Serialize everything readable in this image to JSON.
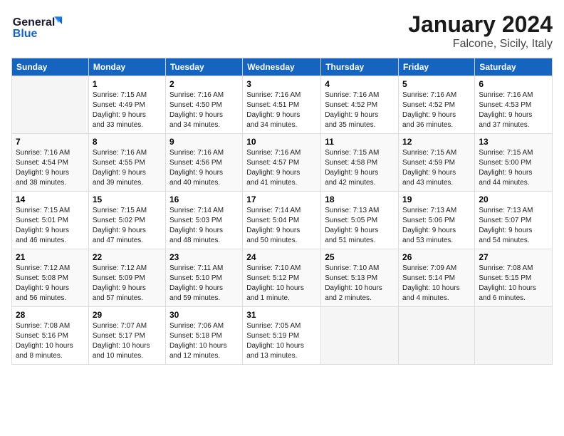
{
  "logo": {
    "line1": "General",
    "line2": "Blue"
  },
  "title": "January 2024",
  "subtitle": "Falcone, Sicily, Italy",
  "headers": [
    "Sunday",
    "Monday",
    "Tuesday",
    "Wednesday",
    "Thursday",
    "Friday",
    "Saturday"
  ],
  "weeks": [
    [
      {
        "day": "",
        "info": ""
      },
      {
        "day": "1",
        "info": "Sunrise: 7:15 AM\nSunset: 4:49 PM\nDaylight: 9 hours\nand 33 minutes."
      },
      {
        "day": "2",
        "info": "Sunrise: 7:16 AM\nSunset: 4:50 PM\nDaylight: 9 hours\nand 34 minutes."
      },
      {
        "day": "3",
        "info": "Sunrise: 7:16 AM\nSunset: 4:51 PM\nDaylight: 9 hours\nand 34 minutes."
      },
      {
        "day": "4",
        "info": "Sunrise: 7:16 AM\nSunset: 4:52 PM\nDaylight: 9 hours\nand 35 minutes."
      },
      {
        "day": "5",
        "info": "Sunrise: 7:16 AM\nSunset: 4:52 PM\nDaylight: 9 hours\nand 36 minutes."
      },
      {
        "day": "6",
        "info": "Sunrise: 7:16 AM\nSunset: 4:53 PM\nDaylight: 9 hours\nand 37 minutes."
      }
    ],
    [
      {
        "day": "7",
        "info": "Sunrise: 7:16 AM\nSunset: 4:54 PM\nDaylight: 9 hours\nand 38 minutes."
      },
      {
        "day": "8",
        "info": "Sunrise: 7:16 AM\nSunset: 4:55 PM\nDaylight: 9 hours\nand 39 minutes."
      },
      {
        "day": "9",
        "info": "Sunrise: 7:16 AM\nSunset: 4:56 PM\nDaylight: 9 hours\nand 40 minutes."
      },
      {
        "day": "10",
        "info": "Sunrise: 7:16 AM\nSunset: 4:57 PM\nDaylight: 9 hours\nand 41 minutes."
      },
      {
        "day": "11",
        "info": "Sunrise: 7:15 AM\nSunset: 4:58 PM\nDaylight: 9 hours\nand 42 minutes."
      },
      {
        "day": "12",
        "info": "Sunrise: 7:15 AM\nSunset: 4:59 PM\nDaylight: 9 hours\nand 43 minutes."
      },
      {
        "day": "13",
        "info": "Sunrise: 7:15 AM\nSunset: 5:00 PM\nDaylight: 9 hours\nand 44 minutes."
      }
    ],
    [
      {
        "day": "14",
        "info": "Sunrise: 7:15 AM\nSunset: 5:01 PM\nDaylight: 9 hours\nand 46 minutes."
      },
      {
        "day": "15",
        "info": "Sunrise: 7:15 AM\nSunset: 5:02 PM\nDaylight: 9 hours\nand 47 minutes."
      },
      {
        "day": "16",
        "info": "Sunrise: 7:14 AM\nSunset: 5:03 PM\nDaylight: 9 hours\nand 48 minutes."
      },
      {
        "day": "17",
        "info": "Sunrise: 7:14 AM\nSunset: 5:04 PM\nDaylight: 9 hours\nand 50 minutes."
      },
      {
        "day": "18",
        "info": "Sunrise: 7:13 AM\nSunset: 5:05 PM\nDaylight: 9 hours\nand 51 minutes."
      },
      {
        "day": "19",
        "info": "Sunrise: 7:13 AM\nSunset: 5:06 PM\nDaylight: 9 hours\nand 53 minutes."
      },
      {
        "day": "20",
        "info": "Sunrise: 7:13 AM\nSunset: 5:07 PM\nDaylight: 9 hours\nand 54 minutes."
      }
    ],
    [
      {
        "day": "21",
        "info": "Sunrise: 7:12 AM\nSunset: 5:08 PM\nDaylight: 9 hours\nand 56 minutes."
      },
      {
        "day": "22",
        "info": "Sunrise: 7:12 AM\nSunset: 5:09 PM\nDaylight: 9 hours\nand 57 minutes."
      },
      {
        "day": "23",
        "info": "Sunrise: 7:11 AM\nSunset: 5:10 PM\nDaylight: 9 hours\nand 59 minutes."
      },
      {
        "day": "24",
        "info": "Sunrise: 7:10 AM\nSunset: 5:12 PM\nDaylight: 10 hours\nand 1 minute."
      },
      {
        "day": "25",
        "info": "Sunrise: 7:10 AM\nSunset: 5:13 PM\nDaylight: 10 hours\nand 2 minutes."
      },
      {
        "day": "26",
        "info": "Sunrise: 7:09 AM\nSunset: 5:14 PM\nDaylight: 10 hours\nand 4 minutes."
      },
      {
        "day": "27",
        "info": "Sunrise: 7:08 AM\nSunset: 5:15 PM\nDaylight: 10 hours\nand 6 minutes."
      }
    ],
    [
      {
        "day": "28",
        "info": "Sunrise: 7:08 AM\nSunset: 5:16 PM\nDaylight: 10 hours\nand 8 minutes."
      },
      {
        "day": "29",
        "info": "Sunrise: 7:07 AM\nSunset: 5:17 PM\nDaylight: 10 hours\nand 10 minutes."
      },
      {
        "day": "30",
        "info": "Sunrise: 7:06 AM\nSunset: 5:18 PM\nDaylight: 10 hours\nand 12 minutes."
      },
      {
        "day": "31",
        "info": "Sunrise: 7:05 AM\nSunset: 5:19 PM\nDaylight: 10 hours\nand 13 minutes."
      },
      {
        "day": "",
        "info": ""
      },
      {
        "day": "",
        "info": ""
      },
      {
        "day": "",
        "info": ""
      }
    ]
  ]
}
